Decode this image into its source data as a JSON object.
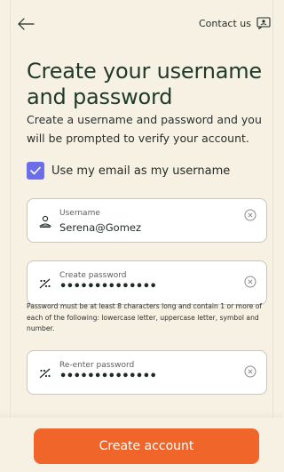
{
  "header": {
    "contact_label": "Contact us"
  },
  "main": {
    "title": "Create your username and password",
    "subtitle": "Create a username and password and you will be prompted to verify your account.",
    "use_email_checkbox": {
      "label": "Use my email as my username",
      "checked": true
    },
    "username_field": {
      "label": "Username",
      "value": "Serena@Gomez"
    },
    "create_password_field": {
      "label": "Create password",
      "value": "••••••••••••••"
    },
    "password_hint": "Password must be at least 8 characters long and contain 1 or more of each of the following: lowercase letter, uppercase letter, symbol and number.",
    "reenter_password_field": {
      "label": "Re-enter password",
      "value": "••••••••••••••"
    }
  },
  "footer": {
    "create_account_label": "Create account"
  },
  "icons": {
    "back": "arrow-left-icon",
    "contact": "chat-card-icon",
    "checkbox": "check-icon",
    "user": "user-icon",
    "password": "password-icon",
    "clear": "clear-icon"
  },
  "colors": {
    "background": "#f7f1e4",
    "accent": "#f06529",
    "checkbox": "#6b6ee8",
    "title": "#1f3a2a"
  }
}
